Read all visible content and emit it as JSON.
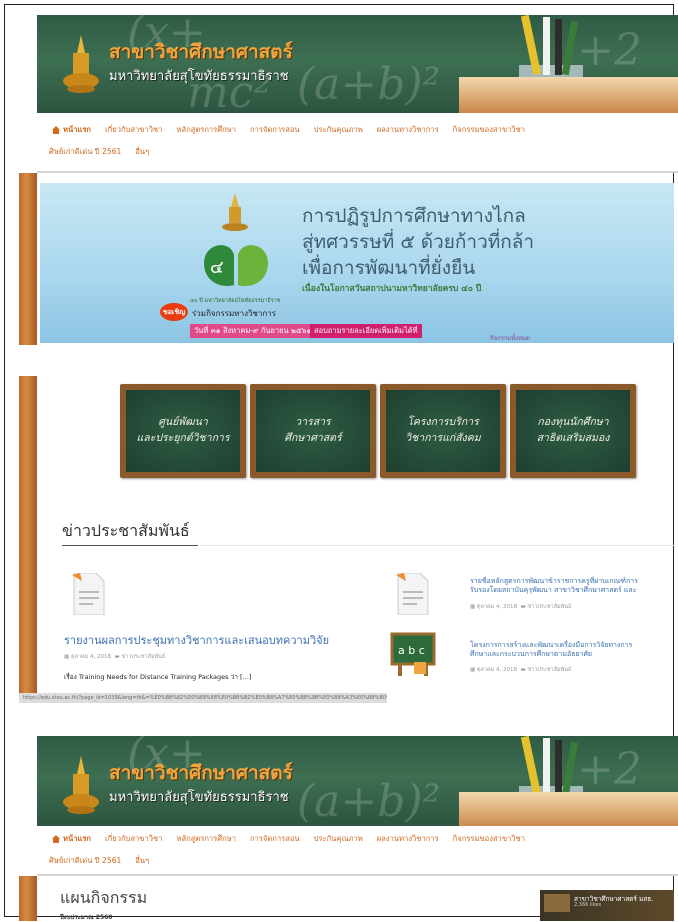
{
  "header": {
    "site_title": "สาขาวิชาศึกษาศาสตร์",
    "site_subtitle": "มหาวิทยาลัยสุโขทัยธรรมาธิราช"
  },
  "nav": {
    "row1": [
      "หน้าแรก",
      "เกี่ยวกับสาขาวิชา",
      "หลักสูตรการศึกษา",
      "การจัดการสอน",
      "ประกันคุณภาพ",
      "ผลงานทางวิชาการ",
      "กิจกรรมของสาขาวิชา"
    ],
    "row2": [
      "ศิษย์เก่าดีเด่น ปี 2561",
      "อื่นๆ"
    ]
  },
  "banner": {
    "line1": "การปฏิรูปการศึกษาทางไกล",
    "line2": "สู่ทศวรรษที่ ๕ ด้วยก้าวที่กล้า",
    "line3": "เพื่อการพัฒนาที่ยั่งยืน",
    "small": "เนื่องในโอกาสวันสถาปนามหาวิทยาลัยครบ ๔๐ ปี",
    "emblem_caption": "๔๐ ปี มหาวิทยาลัยสุโขทัยธรรมาธิราช",
    "join_badge": "ขอเชิญ",
    "join_text": "ร่วมกิจกรรมทางวิชาการ",
    "date_text": "วันที่ ๓๑ สิงหาคม-๙ กันยายน ๒๕๖๑",
    "register_text": "สอบถามรายละเอียดเพิ่มเติมได้ที่",
    "more_text": "กิจกรรมทั้งหมด"
  },
  "boards": [
    {
      "line1": "ศูนย์พัฒนา",
      "line2": "และประยุกต์วิชาการ"
    },
    {
      "line1": "วารสาร",
      "line2": "ศึกษาศาสตร์"
    },
    {
      "line1": "โครงการบริการ",
      "line2": "วิชาการแก่สังคม"
    },
    {
      "line1": "กองทุนนักศึกษา",
      "line2": "สาธิตเสริมสมอง"
    }
  ],
  "news": {
    "heading": "ข่าวประชาสัมพันธ์",
    "main_post": {
      "title": "รายงานผลการประชุมทางวิชาการและเสนอบทความวิจัย",
      "date": "ตุลาคม 4, 2018",
      "category": "ข่าวประชาสัมพันธ์",
      "excerpt": "เรื่อง Training Needs for Distance Training Packages ว่า […]"
    },
    "side_posts": [
      {
        "title_line1": "รายชื่อหลักสูตรการพัฒนาข้าราชการครูที่ผ่านเกณฑ์การ",
        "title_line2": "รับรองโดยสถาบันคุรุพัฒนา สาขาวิชาศึกษาศาสตร์ และ",
        "date": "ตุลาคม 4, 2018",
        "category": "ข่าวประชาสัมพันธ์"
      },
      {
        "title_line1": "โครงการการสร้างและพัฒนาเครื่องมือการวิจัยทางการ",
        "title_line2": "ศึกษาและกระบวนการศึกษาตามอัธยาศัย",
        "date": "ตุลาคม 4, 2018",
        "category": "ข่าวประชาสัมพันธ์"
      }
    ],
    "abc_label": "a b c"
  },
  "statusbar": "https://edu.stou.ac.th/?page_id=1039&lang=th&=%E0%B8%82%E0%B9%88%E0%B8%B2%E0%B8%A7%E0%B8%9B%E0%B8%A3%E0%B8%B0%E0%B8%8A%E0%B8%B2%E0%B8%AA%E0%B8%B1%E0%B8%A1",
  "plan": {
    "heading": "แผนกิจกรรม",
    "subheading": "ปีงบประมาณ 2560"
  },
  "video": {
    "title": "สาขาวิชาศึกษาศาสตร์ มสธ.",
    "subtitle": "2,366 likes"
  },
  "colors": {
    "accent_orange": "#d2691e",
    "title_orange": "#f0a640",
    "link_blue": "#3a6fb0",
    "chalk_green": "#2f5b44"
  }
}
